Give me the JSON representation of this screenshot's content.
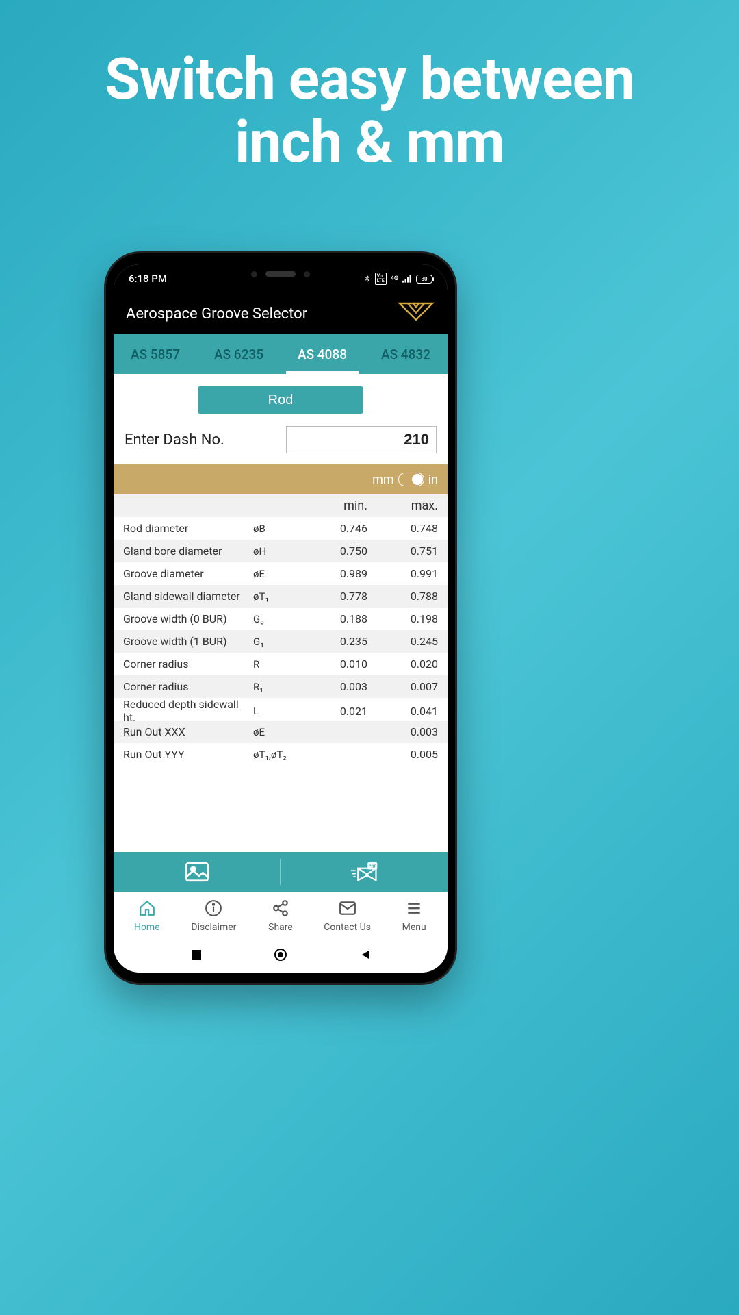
{
  "promo": {
    "line1": "Switch easy between",
    "line2": "inch & mm"
  },
  "status": {
    "time": "6:18 PM",
    "battery": "30"
  },
  "header": {
    "title": "Aerospace Groove Selector"
  },
  "tabs": [
    "AS 5857",
    "AS 6235",
    "AS 4088",
    "AS 4832"
  ],
  "active_tab_index": 2,
  "rod_label": "Rod",
  "dash": {
    "label": "Enter Dash No.",
    "value": "210"
  },
  "units": {
    "left": "mm",
    "right": "in"
  },
  "table": {
    "headers": {
      "min": "min.",
      "max": "max."
    },
    "rows": [
      {
        "label": "Rod diameter",
        "sym": "øB",
        "min": "0.746",
        "max": "0.748"
      },
      {
        "label": "Gland bore diameter",
        "sym": "øH",
        "min": "0.750",
        "max": "0.751"
      },
      {
        "label": "Groove diameter",
        "sym": "øE",
        "min": "0.989",
        "max": "0.991"
      },
      {
        "label": "Gland sidewall diameter",
        "sym": "øT₁",
        "min": "0.778",
        "max": "0.788"
      },
      {
        "label": "Groove width (0 BUR)",
        "sym": "G₀",
        "min": "0.188",
        "max": "0.198"
      },
      {
        "label": "Groove width (1 BUR)",
        "sym": "G₁",
        "min": "0.235",
        "max": "0.245"
      },
      {
        "label": "Corner radius",
        "sym": "R",
        "min": "0.010",
        "max": "0.020"
      },
      {
        "label": "Corner radius",
        "sym": "R₁",
        "min": "0.003",
        "max": "0.007"
      },
      {
        "label": "Reduced depth sidewall ht.",
        "sym": "L",
        "min": "0.021",
        "max": "0.041"
      },
      {
        "label": "Run Out XXX",
        "sym": "øE",
        "min": "",
        "max": "0.003"
      },
      {
        "label": "Run Out YYY",
        "sym": "øT₁,øT₂",
        "min": "",
        "max": "0.005"
      }
    ]
  },
  "bottom_nav": [
    {
      "label": "Home",
      "icon": "home"
    },
    {
      "label": "Disclaimer",
      "icon": "info"
    },
    {
      "label": "Share",
      "icon": "share"
    },
    {
      "label": "Contact Us",
      "icon": "mail"
    },
    {
      "label": "Menu",
      "icon": "menu"
    }
  ],
  "active_nav_index": 0
}
